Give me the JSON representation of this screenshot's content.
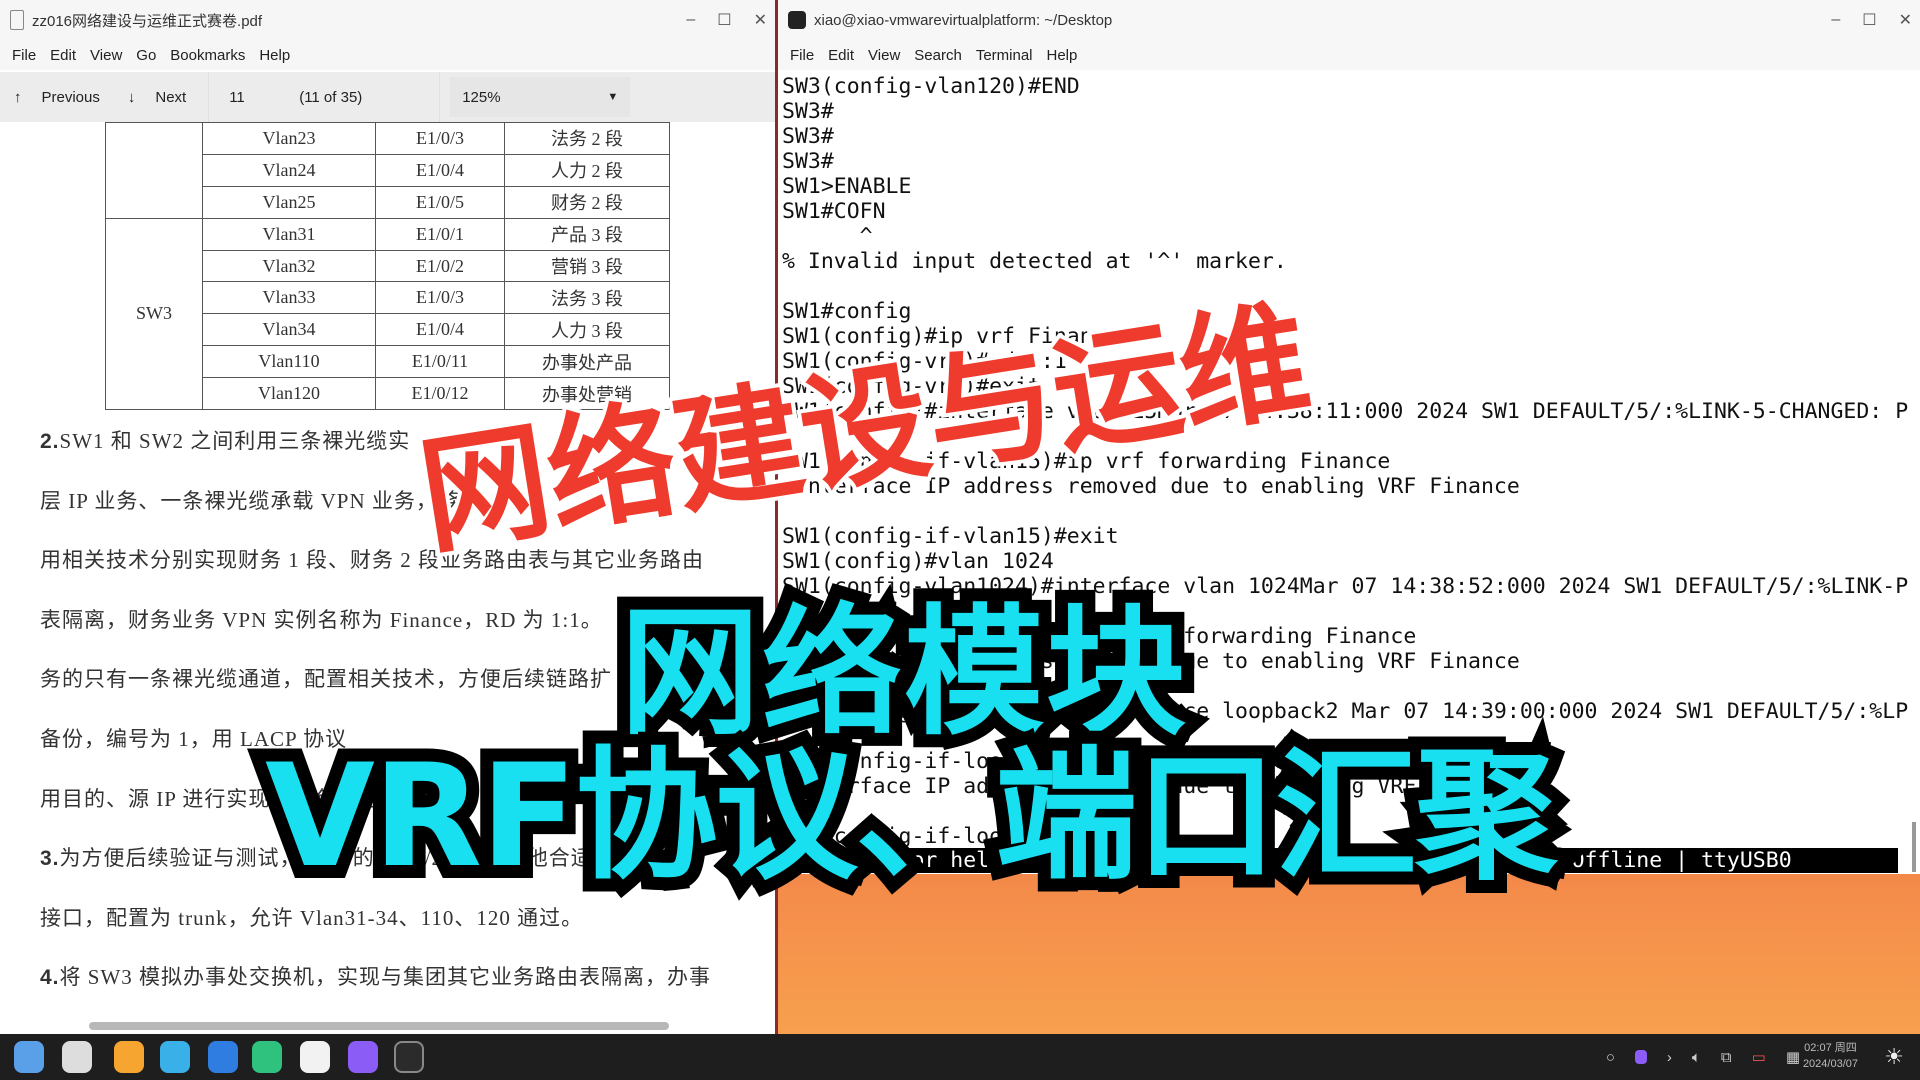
{
  "pdf_viewer": {
    "title": "zz016网络建设与运维正式赛卷.pdf",
    "menu": [
      "File",
      "Edit",
      "View",
      "Go",
      "Bookmarks",
      "Help"
    ],
    "toolbar": {
      "previous": "Previous",
      "next": "Next",
      "page": "11",
      "page_of": "(11 of 35)",
      "zoom": "125%"
    },
    "table": {
      "group_sw3": "SW3",
      "rows": [
        [
          "Vlan23",
          "E1/0/3",
          "法务 2 段"
        ],
        [
          "Vlan24",
          "E1/0/4",
          "人力 2 段"
        ],
        [
          "Vlan25",
          "E1/0/5",
          "财务 2 段"
        ],
        [
          "Vlan31",
          "E1/0/1",
          "产品 3 段"
        ],
        [
          "Vlan32",
          "E1/0/2",
          "营销 3 段"
        ],
        [
          "Vlan33",
          "E1/0/3",
          "法务 3 段"
        ],
        [
          "Vlan34",
          "E1/0/4",
          "人力 3 段"
        ],
        [
          "Vlan110",
          "E1/0/11",
          "办事处产品"
        ],
        [
          "Vlan120",
          "E1/0/12",
          "办事处营销"
        ]
      ]
    },
    "paragraphs": [
      {
        "num": "2.",
        "text": "SW1 和 SW2 之间利用三条裸光缆实"
      },
      {
        "num": "",
        "text": "层 IP 业务、一条裸光缆承载 VPN 业务，                    务。"
      },
      {
        "num": "",
        "text": "用相关技术分别实现财务 1 段、财务 2 段业务路由表与其它业务路由"
      },
      {
        "num": "",
        "text": "表隔离，财务业务 VPN 实例名称为 Finance，RD 为 1:1。"
      },
      {
        "num": "",
        "text": "务的只有一条裸光缆通道，配置相关技术，方便后续链路扩"
      },
      {
        "num": "",
        "text": "备份，编号为 1，用 LACP 协议"
      },
      {
        "num": "",
        "text": "用目的、源 IP 进行实现流量负载分担。"
      },
      {
        "num": "3.",
        "text": "为方便后续验证与测试，SW3 的 E1/0/22 连接其他合适设备的一个"
      },
      {
        "num": "",
        "text": "接口，配置为 trunk，允许 Vlan31-34、110、120 通过。"
      },
      {
        "num": "4.",
        "text": "将 SW3 模拟办事处交换机，实现与集团其它业务路由表隔离，办事"
      }
    ]
  },
  "terminal": {
    "title": "xiao@xiao-vmwarevirtualplatform: ~/Desktop",
    "menu": [
      "File",
      "Edit",
      "View",
      "Search",
      "Terminal",
      "Help"
    ],
    "lines": [
      "SW3(config-vlan120)#END",
      "SW3#",
      "SW3#",
      "SW3#",
      "SW1>ENABLE",
      "SW1#COFN",
      "      ^",
      "% Invalid input detected at '^' marker.",
      "",
      "SW1#config",
      "SW1(config)#ip vrf Finance",
      "SW1(config-vrf)#rd 1:1",
      "SW1(config-vrf)#exit",
      "SW1(config)#interface vlan 15Mar 07 14:38:11:000 2024 SW1 DEFAULT/5/:%LINK-5-CHANGED: P",
      "",
      "SW1(config-if-vlan15)#ip vrf forwarding Finance",
      " Interface IP address removed due to enabling VRF Finance",
      "",
      "SW1(config-if-vlan15)#exit",
      "SW1(config)#vlan 1024",
      "SW1(config-vlan1024)#interface vlan 1024Mar 07 14:38:52:000 2024 SW1 DEFAULT/5/:%LINK-P",
      "",
      "SW1(config-if-vlan1024)#ip vrf forwarding Finance",
      " Interface IP address removed due to enabling VRF Finance",
      "",
      "SW1(config-if-vlan1024)#interface loopback2 Mar 07 14:39:00:000 2024 SW1 DEFAULT/5/:%LP",
      "",
      "SW1(config-if-loopback2)#ip vrf forwarding Finance",
      " Interface IP address removed due to enabling VRF Finance",
      "",
      "SW1(config-if-loopback2)#"
    ],
    "status_bar": "CTRL-A Z for help | 9600 8N1 | NOR | Minicom 2.7.1 | VT102 | Offline | ttyUSB0"
  },
  "overlay": {
    "title_red": "网络建设与运维",
    "subtitle_1": "网络模块",
    "subtitle_2": "VRF协议、端口汇聚"
  },
  "taskbar": {
    "apps": [
      {
        "name": "launcher-icon",
        "color": "#5aa0e8"
      },
      {
        "name": "file-manager-icon",
        "color": "#dddddd"
      },
      {
        "name": "app-store-icon",
        "color": "#f7a531"
      },
      {
        "name": "browser-icon",
        "color": "#3ab0e8"
      },
      {
        "name": "wps-writer-icon",
        "color": "#2f7de1"
      },
      {
        "name": "messaging-icon",
        "color": "#2ec27e"
      },
      {
        "name": "pdf-reader-icon",
        "color": "#f2f2f2"
      },
      {
        "name": "video-app-icon",
        "color": "#8b5cf6"
      },
      {
        "name": "terminal-icon",
        "color": "#2b2b2b"
      }
    ],
    "clock_time": "02:07 周四",
    "clock_date": "2024/03/07"
  },
  "colors": {
    "overlay_red": "#ef3b2d",
    "overlay_cyan": "#19e0f0",
    "desktop_orange": "#f4894a"
  }
}
